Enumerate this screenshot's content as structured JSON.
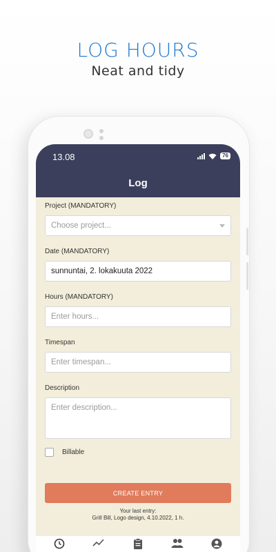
{
  "promo": {
    "title": "LOG HOURS",
    "subtitle": "Neat and tidy"
  },
  "status_bar": {
    "time": "13.08",
    "battery": "76",
    "icons": [
      "signal-icon",
      "wifi-icon",
      "battery-icon"
    ]
  },
  "app_bar": {
    "title": "Log"
  },
  "form": {
    "project": {
      "label": "Project (MANDATORY)",
      "placeholder": "Choose project..."
    },
    "date": {
      "label": "Date (MANDATORY)",
      "value": "sunnuntai, 2. lokakuuta 2022"
    },
    "hours": {
      "label": "Hours (MANDATORY)",
      "placeholder": "Enter hours..."
    },
    "timespan": {
      "label": "Timespan",
      "placeholder": "Enter timespan..."
    },
    "description": {
      "label": "Description",
      "placeholder": "Enter description..."
    },
    "billable": {
      "label": "Billable",
      "checked": false
    },
    "create_button": "CREATE ENTRY",
    "last_entry_title": "Your last entry:",
    "last_entry_text": "Grill Bill, Logo design, 4.10.2022, 1 h."
  },
  "bottom_nav": {
    "items": [
      "clock-icon",
      "trend-icon",
      "clipboard-icon",
      "people-icon",
      "account-icon"
    ],
    "active": "clock-icon"
  },
  "colors": {
    "accent_blue": "#1f78d1",
    "app_bar": "#3c3f5c",
    "background": "#f2eedb",
    "button": "#e07b5c"
  }
}
